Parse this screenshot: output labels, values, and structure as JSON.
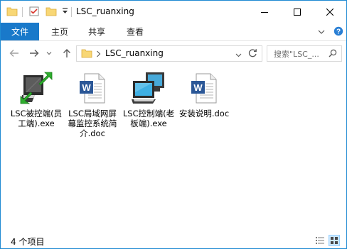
{
  "window": {
    "title": "LSC_ruanxing"
  },
  "ribbon": {
    "tabs": [
      "文件",
      "主页",
      "共享",
      "查看"
    ]
  },
  "address": {
    "path": "LSC_ruanxing"
  },
  "search": {
    "placeholder": "搜索\"LSC_..."
  },
  "files": [
    {
      "label": "LSC被控端(员工端).exe",
      "icon": "green-arrow-monitor-exe-icon"
    },
    {
      "label": "LSC局域网屏幕监控系统简介.doc",
      "icon": "word-document-icon"
    },
    {
      "label": "LSC控制端(老板端).exe",
      "icon": "networked-computers-exe-icon"
    },
    {
      "label": "安装说明.doc",
      "icon": "word-document-icon"
    }
  ],
  "status": {
    "item_count": "4 个项目"
  },
  "colors": {
    "accent": "#1979ca",
    "border": "#1f8ad2"
  }
}
